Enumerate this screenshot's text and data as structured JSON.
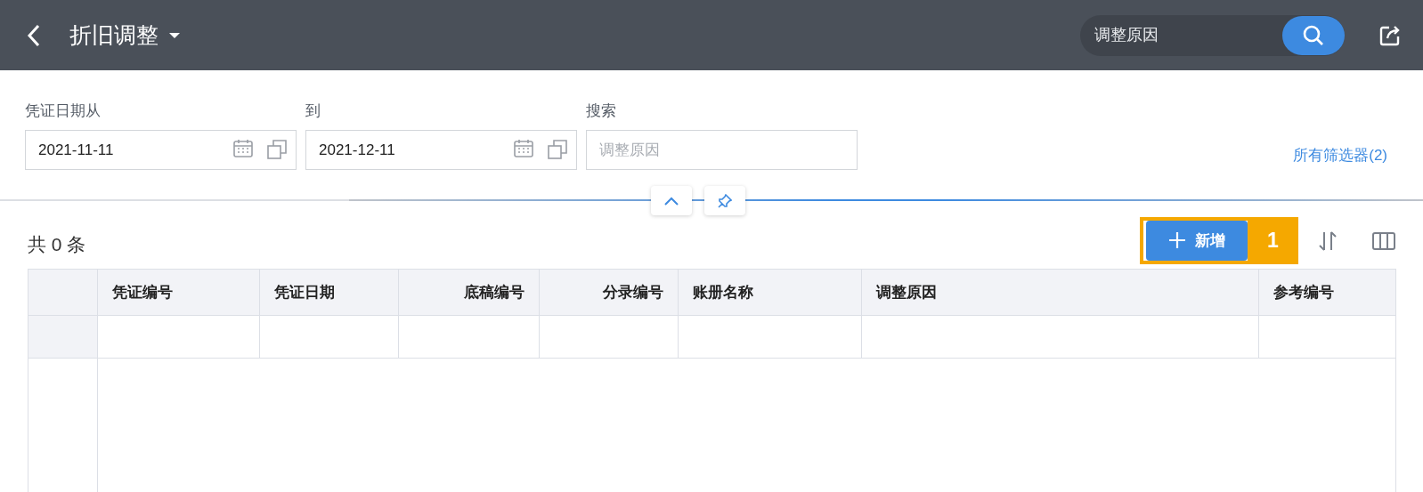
{
  "header": {
    "title": "折旧调整",
    "search": {
      "placeholder": "调整原因"
    }
  },
  "filters": [
    {
      "label": "凭证日期从",
      "kind": "date",
      "value": "2021-11-11"
    },
    {
      "label": "到",
      "kind": "date",
      "value": "2021-12-11"
    },
    {
      "label": "搜索",
      "kind": "text",
      "placeholder": "调整原因"
    }
  ],
  "all_filters_link": "所有筛选器(2)",
  "count_text": "共 0 条",
  "toolbar": {
    "add_button": "新增",
    "callout": "1"
  },
  "table": {
    "columns": [
      {
        "label": "凭证编号"
      },
      {
        "label": "凭证日期"
      },
      {
        "label": "底稿编号"
      },
      {
        "label": "分录编号"
      },
      {
        "label": "账册名称"
      },
      {
        "label": "调整原因"
      },
      {
        "label": "参考编号"
      }
    ]
  }
}
